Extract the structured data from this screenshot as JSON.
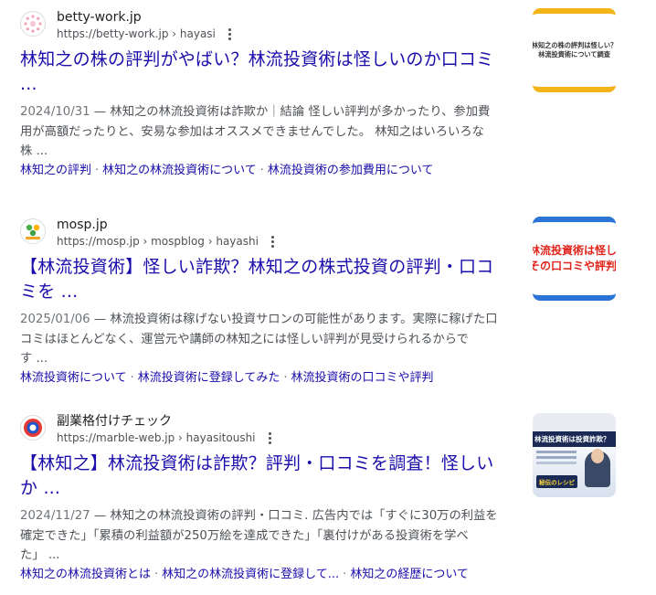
{
  "results": [
    {
      "site_name": "betty-work.jp",
      "url": "https://betty-work.jp › hayasi",
      "title_line1": "林知之の株の評判がやばい？林流投資術は怪しいのか口コミ",
      "title_line2": "...",
      "date": "2024/10/31",
      "snippet_line1": " — 林知之の林流投資術は詐欺か｜結論 怪しい評判が多かったり、参加費",
      "snippet_line2": "用が高額だったりと、安易な参加はオススメできませんでした。 林知之はいろいろな",
      "snippet_line3": "株 ...",
      "sitelinks": [
        "林知之の評判",
        "林知之の林流投資術について",
        "林流投資術の参加費用について"
      ],
      "thumbnail_lines": [
        "林知之の株の評判は怪しい？",
        "林流投資術について調査"
      ]
    },
    {
      "site_name": "mosp.jp",
      "url": "https://mosp.jp › mospblog › hayashi",
      "title_line1": "【林流投資術】怪しい詐欺？林知之の株式投資の評判・口コ",
      "title_line2": "ミを ...",
      "date": "2025/01/06",
      "snippet_line1": " — 林流投資術は稼げない投資サロンの可能性があります。実際に稼げた口",
      "snippet_line2": "コミはほとんどなく、運営元や講師の林知之には怪しい評判が見受けられるからで",
      "snippet_line3": "す ...",
      "sitelinks": [
        "林流投資術について",
        "林流投資術に登録してみた",
        "林流投資術の口コミや評判"
      ],
      "thumbnail_lines": [
        "林流投資術は怪しい",
        "その口コミや評判を"
      ]
    },
    {
      "site_name": "副業格付けチェック",
      "url": "https://marble-web.jp › hayasitoushi",
      "title_line1": "【林知之】林流投資術は詐欺？評判・口コミを調査！怪しい",
      "title_line2": "か ...",
      "date": "2024/11/27",
      "snippet_line1": " — 林知之の林流投資術の評判・口コミ. 広告内では「すぐに30万の利益を",
      "snippet_line2": "確定できた」「累積の利益額が250万絵を達成できた」「裏付けがある投資術を学べ",
      "snippet_line3": "た」 ...",
      "sitelinks": [
        "林知之の林流投資術とは",
        "林知之の林流投資術に登録して...",
        "林知之の経歴について"
      ],
      "thumbnail_lines": [
        "林流投資術は投資詐欺？",
        "秘伝のレシピ"
      ]
    }
  ],
  "colors": {
    "link": "#1a0dab",
    "snippet": "#4d5156",
    "thumb1_border": "#f2b418",
    "thumb2_border": "#2a74d8",
    "thumb2_text": "#e0241b",
    "thumb3_header": "#1b2a55"
  },
  "icons": {
    "menu": "kebab-menu-icon"
  }
}
